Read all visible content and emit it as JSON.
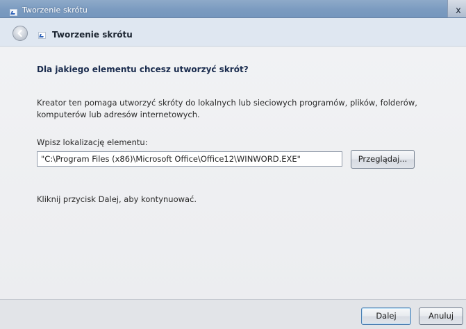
{
  "window": {
    "title": "Tworzenie skrótu",
    "close_glyph": "x"
  },
  "header": {
    "title": "Tworzenie skrótu"
  },
  "main": {
    "question": "Dla jakiego elementu chcesz utworzyć skrót?",
    "description": "Kreator ten pomaga utworzyć skróty do lokalnych lub sieciowych programów, plików, folderów, komputerów lub adresów internetowych.",
    "location_label": "Wpisz lokalizację elementu:",
    "location_value": "\"C:\\Program Files (x86)\\Microsoft Office\\Office12\\WINWORD.EXE\"",
    "browse_label": "Przeglądaj...",
    "hint": "Kliknij przycisk Dalej, aby kontynuować."
  },
  "footer": {
    "next_label": "Dalej",
    "cancel_label": "Anuluj"
  },
  "icons": {
    "back": "back-arrow-icon",
    "shortcut": "shortcut-icon",
    "close": "close-icon"
  }
}
